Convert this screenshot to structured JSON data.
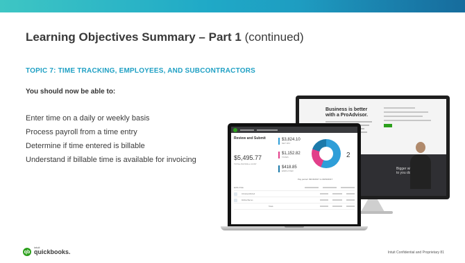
{
  "slide": {
    "title_bold": "Learning Objectives Summary – Part 1",
    "title_light": "(continued)",
    "topic": "TOPIC 7: TIME TRACKING, EMPLOYEES, AND SUBCONTRACTORS",
    "lead": "You should now be able to:",
    "objectives": [
      "Enter time on a daily or weekly basis",
      "Process payroll from a time entry",
      "Determine if time entered is billable",
      "Understand if billable time is available for invoicing"
    ],
    "logo_word": "quickbooks.",
    "logo_small": "intuit",
    "footer": "Intuit Confidential and Proprietary  81"
  },
  "monitor": {
    "headline": "Business is better with a ProAdvisor.",
    "band_text": "Bigger who listen. to you do."
  },
  "laptop": {
    "nav_brand": "quickbooks",
    "title": "Review and Submit",
    "total": "$5,495.77",
    "total_label": "TOTAL PAYROLL COST",
    "stats": [
      {
        "value": "$3,824.10",
        "label": "NET PAY",
        "color": "#2e9ed8"
      },
      {
        "value": "$1,152.82",
        "label": "TAXES",
        "color": "#e23f8a"
      },
      {
        "value": "$418.85",
        "label": "EMPLOYER",
        "color": "#1c7aaa"
      }
    ],
    "right_number": "2",
    "pay_period": "Pay period: 09/16/2017 to 09/30/2017",
    "rows": [
      "EMPLOYEE",
      "Christina Mitchell",
      "Robbie Barnes",
      "Totals"
    ]
  },
  "colors": {
    "accent": "#1fa0c4",
    "band_start": "#3ec6c4",
    "band_end": "#1d86b6",
    "qb_green": "#2ca01c"
  }
}
